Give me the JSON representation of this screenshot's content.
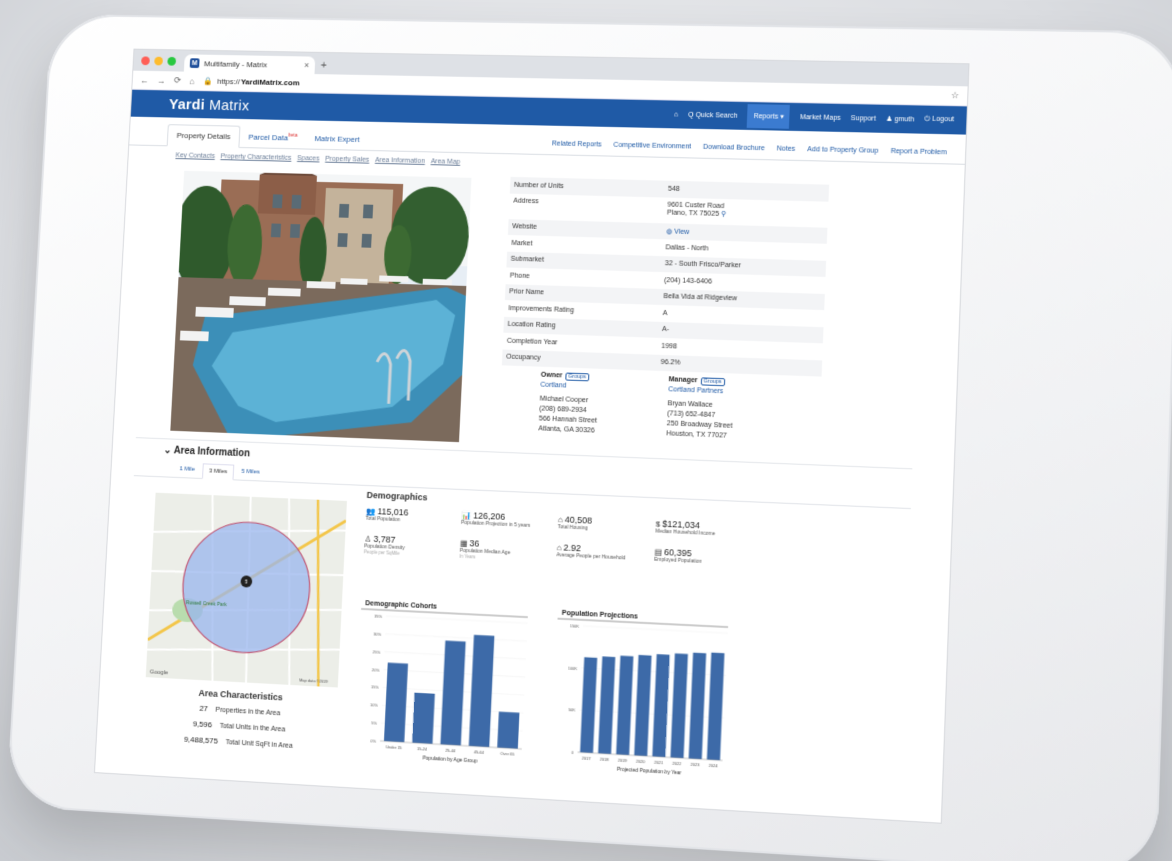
{
  "browser": {
    "tab_title": "Multifamily - Matrix",
    "favicon": "M",
    "close": "×",
    "new_tab": "+",
    "url_prefix": "https://",
    "url_domain": "YardiMatrix.com"
  },
  "app": {
    "logo_brand": "Yardi",
    "logo_product": "Matrix",
    "nav": {
      "home": "⌂",
      "quick_search": "Q Quick Search",
      "reports": "Reports ▾",
      "market_maps": "Market Maps",
      "support": "Support",
      "user": "gmuth",
      "logout": "Logout"
    }
  },
  "tabs": {
    "property_details": "Property Details",
    "parcel_data": "Parcel Data",
    "parcel_badge": "beta",
    "matrix_expert": "Matrix Expert",
    "right_links": [
      "Related Reports",
      "Competitive Environment",
      "Download Brochure",
      "Notes",
      "Add to Property Group",
      "Report a Problem"
    ]
  },
  "subnav": [
    "Key Contacts",
    "Property Characteristics",
    "Spaces",
    "Property Sales",
    "Area Information",
    "Area Map"
  ],
  "property": {
    "rows": [
      {
        "k": "Number of Units",
        "v": "548"
      },
      {
        "k": "Address",
        "v": "9601 Custer Road",
        "v2": "Plano, TX 75025"
      },
      {
        "k": "Website",
        "v": "View"
      },
      {
        "k": "Market",
        "v": "Dallas - North"
      },
      {
        "k": "Submarket",
        "v": "32 - South Frisco/Parker"
      },
      {
        "k": "Phone",
        "v": "(204) 143-6406"
      },
      {
        "k": "Prior Name",
        "v": "Bella Vida at Ridgeview"
      },
      {
        "k": "Improvements Rating",
        "v": "A"
      },
      {
        "k": "Location Rating",
        "v": "A-"
      },
      {
        "k": "Completion Year",
        "v": "1998"
      },
      {
        "k": "Occupancy",
        "v": "96.2%"
      }
    ],
    "owner": {
      "label": "Owner",
      "groups": "Groups",
      "company": "Cortland",
      "name": "Michael Cooper",
      "phone": "(208) 689-2934",
      "street": "566 Hannah Street",
      "city": "Atlanta, GA 30326"
    },
    "manager": {
      "label": "Manager",
      "groups": "Groups",
      "company": "Cortland Partners",
      "name": "Bryan Wallace",
      "phone": "(713) 652-4847",
      "street": "250 Broadway Street",
      "city": "Houston, TX 77027"
    }
  },
  "area": {
    "title": "Area Information",
    "radius_tabs": [
      "1 Mile",
      "3 Miles",
      "5 Miles"
    ],
    "map": {
      "park_label": "Russell Creek Park",
      "pin_label": "5",
      "google": "Google",
      "credit": "Map data ©2019"
    },
    "characteristics": {
      "title": "Area Characteristics",
      "rows": [
        {
          "v": "27",
          "l": "Properties in the Area"
        },
        {
          "v": "9,596",
          "l": "Total Units in the Area"
        },
        {
          "v": "9,488,575",
          "l": "Total Unit SqFt in Area"
        }
      ]
    }
  },
  "demographics": {
    "title": "Demographics",
    "stats": [
      {
        "icon": "people-icon",
        "glyph": "👥",
        "num": "115,016",
        "lbl": "Total Population",
        "sub": ""
      },
      {
        "icon": "bar-chart-icon",
        "glyph": "📊",
        "num": "126,206",
        "lbl": "Population Projection in 5 years",
        "sub": ""
      },
      {
        "icon": "home-icon",
        "glyph": "⌂",
        "num": "40,508",
        "lbl": "Total Housing",
        "sub": ""
      },
      {
        "icon": "money-icon",
        "glyph": "$",
        "num": "$121,034",
        "lbl": "Median Household Income",
        "sub": ""
      },
      {
        "icon": "person-icon",
        "glyph": "♙",
        "num": "3,787",
        "lbl": "Population Density",
        "sub": "People per SqMile"
      },
      {
        "icon": "calendar-icon",
        "glyph": "▦",
        "num": "36",
        "lbl": "Population Median Age",
        "sub": "In Years"
      },
      {
        "icon": "household-icon",
        "glyph": "⌂",
        "num": "2.92",
        "lbl": "Average People per Household",
        "sub": ""
      },
      {
        "icon": "briefcase-icon",
        "glyph": "▤",
        "num": "60,395",
        "lbl": "Employed Population",
        "sub": ""
      }
    ]
  },
  "chart_data": [
    {
      "type": "bar",
      "title": "Demographic Cohorts",
      "xlabel": "Population by Age Group",
      "categories": [
        "Under 15",
        "15-24",
        "25-44",
        "45-64",
        "Over 65"
      ],
      "values": [
        22,
        14,
        29,
        31,
        10
      ],
      "yticks": [
        "0%",
        "5%",
        "10%",
        "15%",
        "20%",
        "25%",
        "30%",
        "35%"
      ],
      "ylim": [
        0,
        35
      ],
      "color": "#3d6aa8"
    },
    {
      "type": "bar",
      "title": "Population Projections",
      "xlabel": "Projected Population by Year",
      "categories": [
        "2017",
        "2018",
        "2019",
        "2020",
        "2021",
        "2022",
        "2023",
        "2024"
      ],
      "values": [
        113000,
        115000,
        117000,
        119000,
        121000,
        123000,
        125000,
        126206
      ],
      "yticks": [
        "0",
        "50K",
        "100K",
        "150K"
      ],
      "ylim": [
        0,
        150000
      ],
      "color": "#3d6aa8"
    }
  ]
}
